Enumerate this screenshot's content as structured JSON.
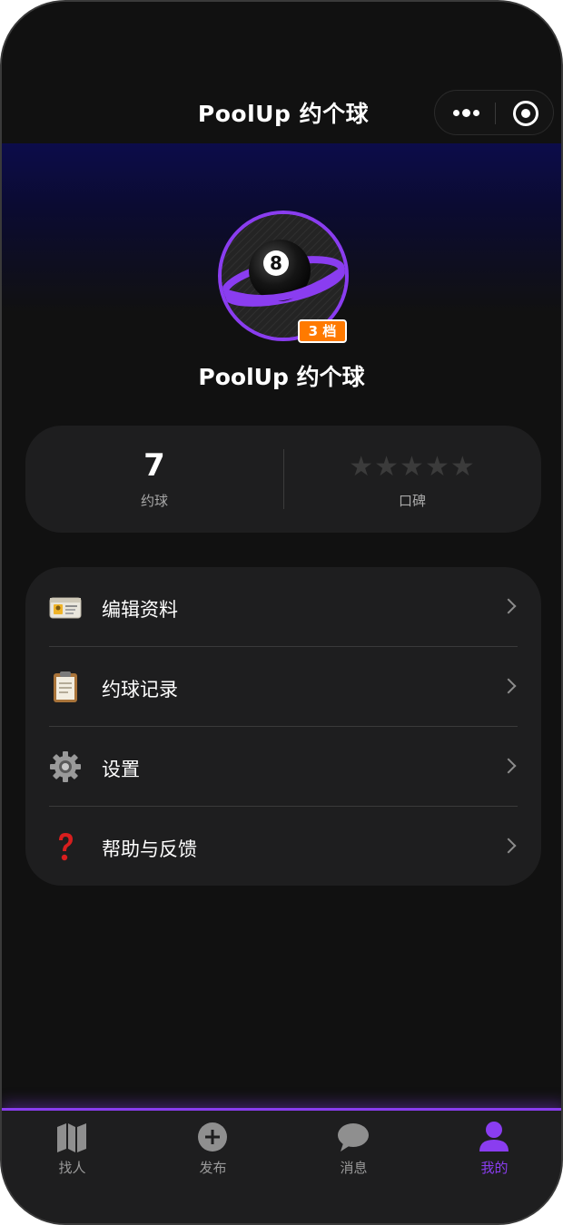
{
  "navbar": {
    "title": "PoolUp 约个球",
    "more_icon": "more-dots-icon",
    "close_icon": "capsule-close-icon"
  },
  "profile": {
    "avatar_icon": "eight-ball-planet-icon",
    "tier_badge": "3 档",
    "nickname": "PoolUp 约个球"
  },
  "stats": {
    "games_value": "7",
    "games_label": "约球",
    "rating_label": "口碑",
    "rating_stars_filled": 0,
    "rating_stars_total": 5,
    "star_glyph": "★"
  },
  "menu": {
    "items": [
      {
        "label": "编辑资料",
        "icon": "id-card-icon"
      },
      {
        "label": "约球记录",
        "icon": "clipboard-icon"
      },
      {
        "label": "设置",
        "icon": "gear-icon"
      },
      {
        "label": "帮助与反馈",
        "icon": "question-mark-icon"
      }
    ]
  },
  "tabbar": {
    "tabs": [
      {
        "label": "找人",
        "icon": "map-icon",
        "active": false
      },
      {
        "label": "发布",
        "icon": "plus-circle-icon",
        "active": false
      },
      {
        "label": "消息",
        "icon": "chat-bubble-icon",
        "active": false
      },
      {
        "label": "我的",
        "icon": "user-icon",
        "active": true
      }
    ]
  },
  "colors": {
    "accent": "#8a3df0",
    "badge": "#ff7a00",
    "background": "#111111",
    "card": "#1e1e1f"
  }
}
